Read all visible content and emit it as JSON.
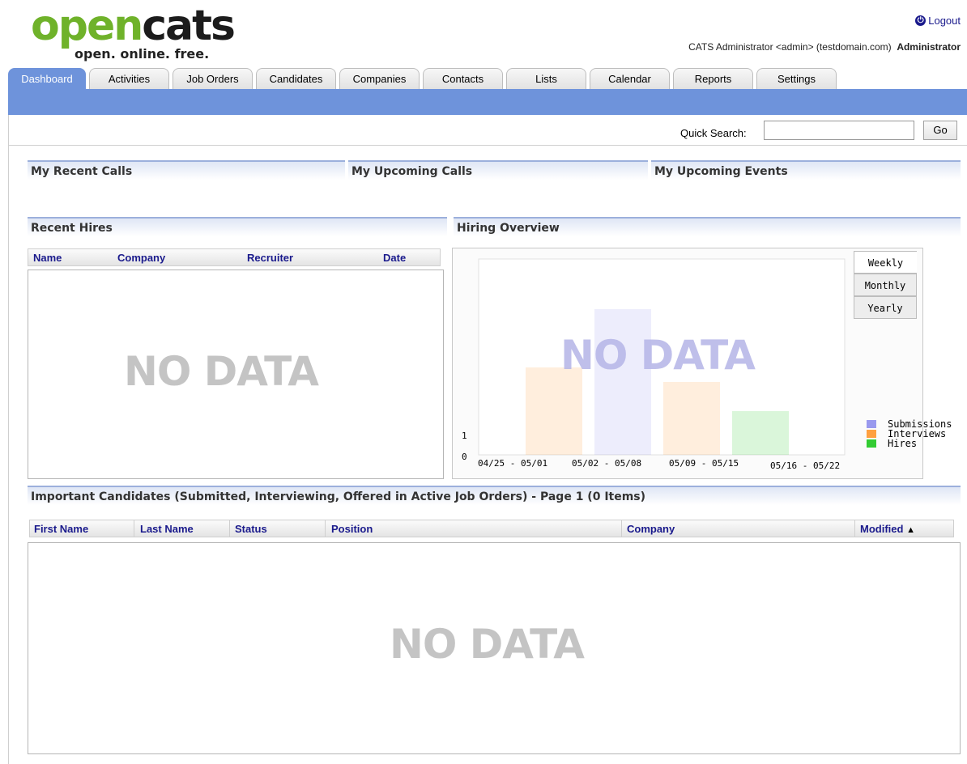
{
  "brand": {
    "logo_green": "open",
    "logo_dark": "cats",
    "tagline": "open. online. free."
  },
  "header": {
    "logout_label": "Logout",
    "user_text": "CATS Administrator <admin> (testdomain.com)",
    "role": "Administrator"
  },
  "tabs": [
    {
      "label": "Dashboard"
    },
    {
      "label": "Activities"
    },
    {
      "label": "Job Orders"
    },
    {
      "label": "Candidates"
    },
    {
      "label": "Companies"
    },
    {
      "label": "Contacts"
    },
    {
      "label": "Lists"
    },
    {
      "label": "Calendar"
    },
    {
      "label": "Reports"
    },
    {
      "label": "Settings"
    }
  ],
  "active_tab": "Dashboard",
  "search": {
    "label": "Quick Search:",
    "value": "",
    "go_label": "Go"
  },
  "sections": {
    "recent_calls": "My Recent Calls",
    "upcoming_calls": "My Upcoming Calls",
    "upcoming_events": "My Upcoming Events",
    "recent_hires": "Recent Hires",
    "hiring_overview": "Hiring Overview",
    "important_candidates": "Important Candidates (Submitted, Interviewing, Offered in Active Job Orders) - Page 1 (0 Items)"
  },
  "recent_hires": {
    "columns": [
      "Name",
      "Company",
      "Recruiter",
      "Date"
    ],
    "rows": [],
    "empty_text": "NO DATA"
  },
  "important_candidates": {
    "columns": [
      "First Name",
      "Last Name",
      "Status",
      "Position",
      "Company",
      "Modified"
    ],
    "sort_indicator": "▲",
    "rows": [],
    "empty_text": "NO DATA"
  },
  "hiring_overview": {
    "period_tabs": [
      "Weekly",
      "Monthly",
      "Yearly"
    ],
    "active_period": "Weekly",
    "overlay_text": "NO DATA",
    "colors": {
      "Submissions": "#9999ee",
      "Interviews": "#ffa040",
      "Hires": "#33cc33"
    }
  },
  "chart_data": {
    "type": "bar",
    "categories": [
      "04/25 - 05/01",
      "05/02 - 05/08",
      "05/09 - 05/15",
      "05/16 - 05/22"
    ],
    "series": [
      {
        "name": "Interviews",
        "values": [
          6,
          0,
          5,
          0
        ]
      },
      {
        "name": "Submissions",
        "values": [
          0,
          10,
          0,
          0
        ]
      },
      {
        "name": "Hires",
        "values": [
          0,
          0,
          0,
          3
        ]
      }
    ],
    "y_ticks": [
      "0",
      "1"
    ],
    "ylim": [
      0,
      10
    ],
    "legend": [
      "Submissions",
      "Interviews",
      "Hires"
    ],
    "legend_position": "bottom-right",
    "title": "",
    "xlabel": "",
    "ylabel": ""
  }
}
